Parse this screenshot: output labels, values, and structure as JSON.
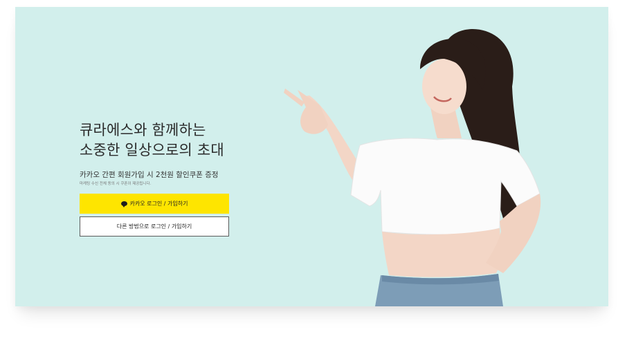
{
  "hero": {
    "headline_line1": "큐라에스와 함께하는",
    "headline_line2": "소중한 일상으로의 초대",
    "promo": "카카오 간편 회원가입 시 2천원 할인쿠폰 증정",
    "promo_note": "마케팅 수신 전체 동의 시 쿠폰이 제공됩니다."
  },
  "buttons": {
    "kakao_label": "카카오 로그인 / 가입하기",
    "other_label": "다른 방법으로 로그인 / 가입하기"
  },
  "icons": {
    "kakao": "speech-bubble-icon"
  },
  "colors": {
    "background": "#d2efec",
    "kakao_yellow": "#fee500",
    "text": "#2b2b2b"
  }
}
